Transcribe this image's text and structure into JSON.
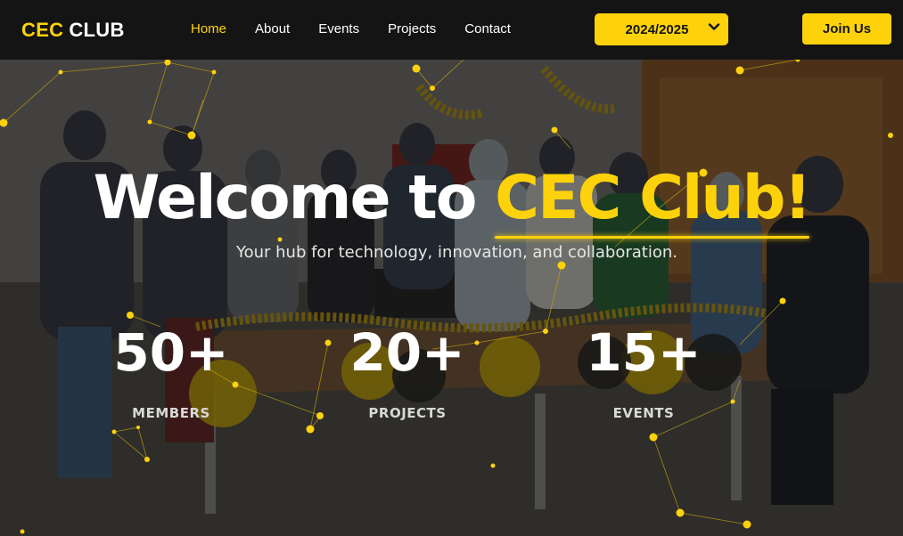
{
  "nav": {
    "logo_part1": "CEC",
    "logo_part2": "CLUB",
    "links": [
      "Home",
      "About",
      "Events",
      "Projects",
      "Contact"
    ],
    "active_link": "Home",
    "year_select": {
      "value": "2024/2025"
    },
    "join_label": "Join Us"
  },
  "hero": {
    "title_prefix": "Welcome to",
    "title_highlight": "CEC Club!",
    "subtitle": "Your hub for technology, innovation, and collaboration.",
    "stats": [
      {
        "value": "50+",
        "label": "MEMBERS"
      },
      {
        "value": "20+",
        "label": "PROJECTS"
      },
      {
        "value": "15+",
        "label": "EVENTS"
      }
    ]
  },
  "colors": {
    "accent": "#fdd20a",
    "navbar": "#141414",
    "text": "#ffffff"
  },
  "icons": {
    "select_arrow": "chevron-down-icon"
  }
}
